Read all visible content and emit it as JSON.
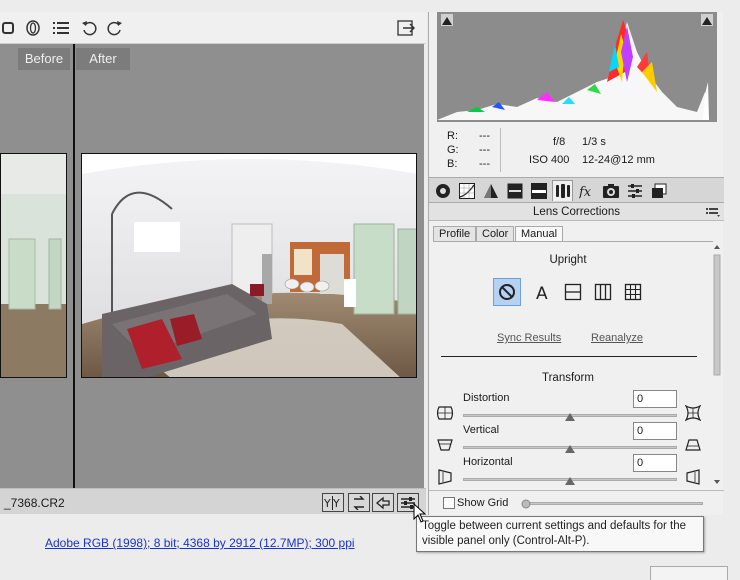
{
  "preview": {
    "before_label": "Before",
    "after_label": "After",
    "filename": "_7368.CR2",
    "workflow_options": "Adobe RGB (1998); 8 bit; 4368 by 2912 (12.7MP); 300 ppi"
  },
  "readout": {
    "r_label": "R:",
    "g_label": "G:",
    "b_label": "B:",
    "r_value": "---",
    "g_value": "---",
    "b_value": "---",
    "aperture": "f/8",
    "shutter": "1/3 s",
    "iso": "ISO 400",
    "lens": "12-24@12 mm"
  },
  "panel": {
    "title": "Lens Corrections",
    "tabs": [
      "Profile",
      "Color",
      "Manual"
    ],
    "upright_label": "Upright",
    "sync_results": "Sync Results",
    "reanalyze": "Reanalyze",
    "transform_label": "Transform",
    "sliders": [
      {
        "label": "Distortion",
        "value": "0",
        "position": 0.5
      },
      {
        "label": "Vertical",
        "value": "0",
        "position": 0.5
      },
      {
        "label": "Horizontal",
        "value": "0",
        "position": 0.5
      }
    ],
    "show_grid": "Show Grid"
  },
  "tooltip": {
    "line1": "Toggle between current settings and defaults for the",
    "line2": "visible panel only (Control-Alt-P)."
  },
  "colors": {
    "preview_bg": "#8f8f8f",
    "active_blue": "#b5d2f2",
    "link_blue": "#1a33cc"
  }
}
